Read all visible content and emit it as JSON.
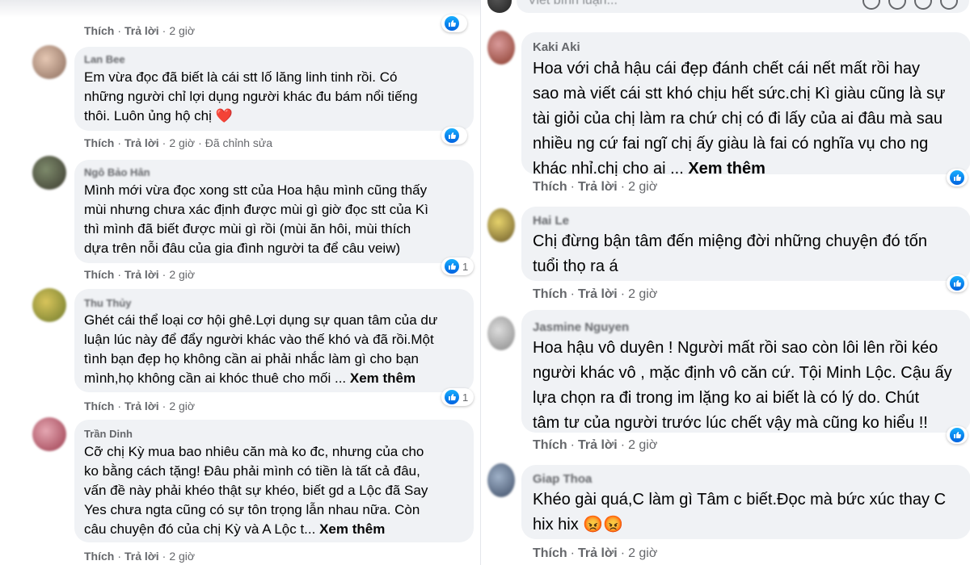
{
  "left": {
    "comments": [
      {
        "name": "",
        "lines": [],
        "see_more": "",
        "actions": {
          "like": "Thích",
          "reply": "Trả lời",
          "time": "2 giờ",
          "edited": ""
        },
        "reactions": ""
      },
      {
        "name": "Lan Bee",
        "lines": [
          "Em vừa đọc đã biết là cái stt lố lăng linh tinh rồi. Có",
          "những người chỉ lợi dụng người khác đu bám nổi tiếng",
          "thôi. Luôn ủng hộ chị"
        ],
        "emoji": "❤️",
        "see_more": "",
        "actions": {
          "like": "Thích",
          "reply": "Trả lời",
          "time": "2 giờ",
          "edited": "Đã chỉnh sửa"
        },
        "reactions": ""
      },
      {
        "name": "Ngô Bảo Hân",
        "lines": [
          "Mình mới vừa đọc xong stt của Hoa hậu mình cũng thấy",
          "mùi nhưng chưa xác định được mùi gì giờ đọc stt của Kì",
          "thì mình đã biết được mùi gì rồi (mùi ăn hôi, mùi thích",
          "dựa trên nỗi đâu của gia đình người ta để câu veiw)"
        ],
        "see_more": "",
        "actions": {
          "like": "Thích",
          "reply": "Trả lời",
          "time": "2 giờ",
          "edited": ""
        },
        "reactions": "1"
      },
      {
        "name": "Thu Thủy",
        "lines": [
          "Ghét cái thể loại cơ hội ghê.Lợi dụng sự quan tâm của dư",
          "luận lúc này để đẩy người khác vào thế khó và đã rồi.Một",
          "tình bạn đẹp họ không cần ai phải nhắc làm gì cho bạn",
          "mình,họ không cần ai khóc thuê cho mối ..."
        ],
        "see_more": "Xem thêm",
        "actions": {
          "like": "Thích",
          "reply": "Trả lời",
          "time": "2 giờ",
          "edited": ""
        },
        "reactions": "1"
      },
      {
        "name": "Trần Dinh",
        "lines": [
          "Cỡ chị Kỳ mua bao nhiêu căn mà ko đc, nhưng của cho",
          "ko bằng cách tặng! Đâu phải mình có tiền là tất cả đâu,",
          "vấn đề này phải khéo thật sự khéo, biết gd a Lộc đã Say",
          "Yes chưa ngta cũng có sự tôn trọng lẫn nhau nữa. Còn",
          "câu chuyện đó của chị Kỳ và A Lộc t..."
        ],
        "see_more": "Xem thêm",
        "actions": {
          "like": "Thích",
          "reply": "Trả lời",
          "time": "2 giờ",
          "edited": ""
        },
        "reactions": ""
      }
    ]
  },
  "right": {
    "input_placeholder": "Viết bình luận...",
    "comments": [
      {
        "name": "Kaki Aki",
        "lines": [
          "Hoa với chả hậu cái đẹp đánh chết cái nết mất rồi hay",
          "sao mà viết cái stt khó chịu hết sức.chị Kì giàu cũng là sự",
          "tài giỏi của chị làm ra chứ chị có đi lấy của ai đâu mà sau",
          "nhiều ng cứ fai ngĩ chị ấy giàu là fai có nghĩa vụ cho ng",
          "khác nhỉ.chị cho ai ..."
        ],
        "see_more": "Xem thêm",
        "actions": {
          "like": "Thích",
          "reply": "Trả lời",
          "time": "2 giờ"
        }
      },
      {
        "name": "Hai Le",
        "lines": [
          "Chị đừng bận tâm đến miệng đời những chuyện đó tốn",
          "tuổi thọ ra á"
        ],
        "see_more": "",
        "actions": {
          "like": "Thích",
          "reply": "Trả lời",
          "time": "2 giờ"
        }
      },
      {
        "name": "Jasmine Nguyen",
        "lines": [
          "Hoa hậu vô duyên ! Người mất rồi sao còn lôi lên rồi kéo",
          "người khác vô , mặc định vô căn cứ. Tội Minh Lộc. Cậu ấy",
          "lựa chọn ra đi trong im lặng ko ai biết là có lý do. Chút",
          "tâm tư của người trước lúc chết vậy mà cũng ko hiểu !!"
        ],
        "see_more": "",
        "actions": {
          "like": "Thích",
          "reply": "Trả lời",
          "time": "2 giờ"
        }
      },
      {
        "name": "Giap Thoa",
        "lines": [
          "Khéo gài quá,C làm gì Tâm c biết.Đọc mà bức xúc thay C",
          "hix hix"
        ],
        "emoji": "😡😡",
        "see_more": "",
        "actions": {
          "like": "Thích",
          "reply": "Trả lời",
          "time": "2 giờ"
        }
      }
    ]
  }
}
